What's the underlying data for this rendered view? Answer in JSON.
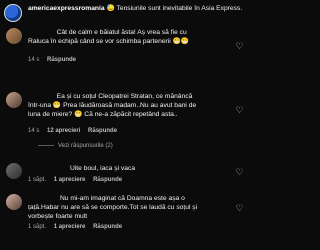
{
  "caption": {
    "username": "americaexpressromania",
    "text": "Tensiunile sunt inevitabile în Asia Express."
  },
  "comments": [
    {
      "text_line1": "Cât de calm e băiatul ăsta! Aș vrea să fie cu",
      "text_line2": "Raluca în echipă când se vor schimba partenerii",
      "time": "14 s",
      "reply_label": "Răspunde",
      "replies_label": null
    },
    {
      "text_line1": "Ea și cu soțul Cleopatrei Stratan, ce mănâncă",
      "text_line2": "într-una",
      "text_line2b": "Prea lăudăroasă madam..Nu au avut bani de",
      "text_line3": "luna de miere?",
      "text_line3b": "Că ne-a zăpăcit repetând asta..",
      "time": "14 s",
      "likes": "12 aprecieri",
      "reply_label": "Răspunde",
      "replies_label": "Vezi răspunsurile (2)"
    },
    {
      "text_line1": "Uite boul, iaca și vaca",
      "time": "1 săpt.",
      "likes": "1 apreciere",
      "reply_label": "Răspunde"
    },
    {
      "text_line1": "Nu mi-am imaginat că Doamna este așa o",
      "text_line2": "țață.Habar nu are să se comporte.Tot se laudă cu soțul și",
      "text_line3": "vorbește foarte mult",
      "time": "1 săpt.",
      "likes": "1 apreciere",
      "reply_label": "Răspunde"
    }
  ],
  "icons": {
    "heart": "heart-outline-icon",
    "tension_emoji": "sad-face-emoji"
  },
  "colors": {
    "background": "#0b0b0b",
    "text": "#f2f2f2",
    "muted": "#a8a8a8"
  }
}
